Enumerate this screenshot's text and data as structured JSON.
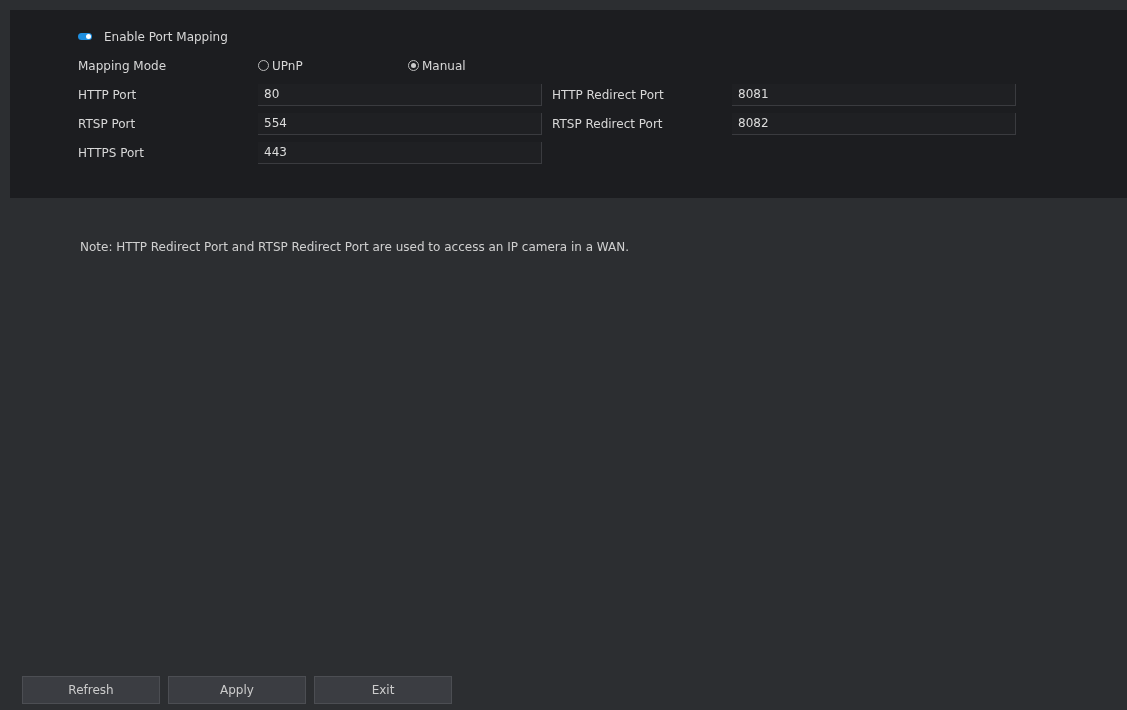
{
  "enable": {
    "label": "Enable Port Mapping",
    "on": true
  },
  "mode": {
    "label": "Mapping Mode",
    "options": [
      {
        "label": "UPnP",
        "selected": false
      },
      {
        "label": "Manual",
        "selected": true
      }
    ]
  },
  "ports": [
    [
      {
        "label": "HTTP Port",
        "value": "80"
      },
      {
        "label": "HTTP Redirect Port",
        "value": "8081"
      }
    ],
    [
      {
        "label": "RTSP Port",
        "value": "554"
      },
      {
        "label": "RTSP Redirect Port",
        "value": "8082"
      }
    ],
    [
      {
        "label": "HTTPS Port",
        "value": "443"
      }
    ]
  ],
  "note": "Note: HTTP Redirect Port and RTSP Redirect Port are used to access an IP camera in a WAN.",
  "buttons": [
    "Refresh",
    "Apply",
    "Exit"
  ]
}
